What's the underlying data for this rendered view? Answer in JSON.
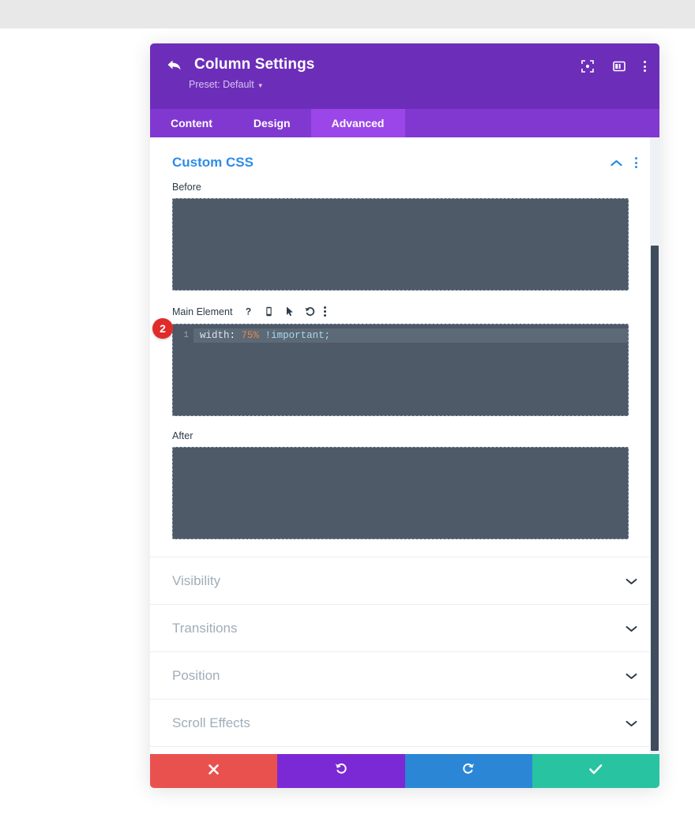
{
  "window": {
    "background_color": "#ffffff",
    "top_strip_color": "#e8e8e8"
  },
  "modal": {
    "title": "Column Settings",
    "back_icon": "back-arrow-icon",
    "preset_label": "Preset: Default",
    "header_color": "#6c2eb9",
    "header_icons": [
      {
        "name": "focus-mode-icon"
      },
      {
        "name": "layout-panel-icon"
      },
      {
        "name": "more-options-icon"
      }
    ],
    "tabs": [
      {
        "label": "Content",
        "active": false
      },
      {
        "label": "Design",
        "active": false
      },
      {
        "label": "Advanced",
        "active": true
      }
    ],
    "tab_bar_color": "#8138d0",
    "tab_active_color": "#9b46e8"
  },
  "custom_css": {
    "section_title": "Custom CSS",
    "section_title_color": "#2d8ce8",
    "collapse_icon": "chevron-up-icon",
    "menu_icon": "more-options-icon",
    "fields": {
      "before": {
        "label": "Before",
        "value": ""
      },
      "main_element": {
        "label": "Main Element",
        "icons": [
          {
            "name": "help-icon",
            "glyph": "?"
          },
          {
            "name": "responsive-device-icon"
          },
          {
            "name": "hover-cursor-icon"
          },
          {
            "name": "reset-icon"
          },
          {
            "name": "more-options-icon"
          }
        ],
        "badge": "2",
        "badge_color": "#e02b2b",
        "line_number": "1",
        "code": {
          "property": "width",
          "colon": ":",
          "value": "75%",
          "important": "!important;"
        }
      },
      "after": {
        "label": "After",
        "value": ""
      }
    },
    "editor_colors": {
      "background": "#4e5a68",
      "active_line": "#5c6977",
      "property": "#dbe4ec",
      "value": "#e8874a",
      "important": "#a8d8e8"
    }
  },
  "accordion": [
    {
      "label": "Visibility",
      "icon": "chevron-down-icon"
    },
    {
      "label": "Transitions",
      "icon": "chevron-down-icon"
    },
    {
      "label": "Position",
      "icon": "chevron-down-icon"
    },
    {
      "label": "Scroll Effects",
      "icon": "chevron-down-icon"
    }
  ],
  "footer": {
    "buttons": [
      {
        "name": "cancel-button",
        "icon": "close-icon",
        "glyph": "✖",
        "color": "#e9514f"
      },
      {
        "name": "undo-button",
        "icon": "undo-icon",
        "glyph": "↺",
        "color": "#7b29d4"
      },
      {
        "name": "redo-button",
        "icon": "redo-icon",
        "glyph": "↻",
        "color": "#2b86d6"
      },
      {
        "name": "save-button",
        "icon": "check-icon",
        "glyph": "✔",
        "color": "#28c3a0"
      }
    ]
  },
  "scrollbar": {
    "name": "vertical-scrollbar",
    "thumb_color": "#3f4d5c"
  }
}
